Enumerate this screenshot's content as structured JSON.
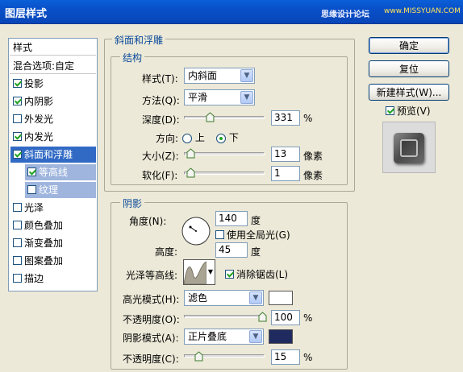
{
  "window": {
    "title": "图层样式",
    "watermark": "思缘设计论坛",
    "watermark_url": "www.MISSYUAN.COM"
  },
  "style_list": {
    "header": "样式",
    "blend_options": "混合选项:自定",
    "items": [
      {
        "label": "投影",
        "checked": true
      },
      {
        "label": "内阴影",
        "checked": true
      },
      {
        "label": "外发光",
        "checked": false
      },
      {
        "label": "内发光",
        "checked": true
      },
      {
        "label": "斜面和浮雕",
        "checked": true,
        "selected": true
      },
      {
        "label": "等高线",
        "checked": true,
        "sub": true
      },
      {
        "label": "纹理",
        "checked": false,
        "sub": true
      },
      {
        "label": "光泽",
        "checked": false
      },
      {
        "label": "颜色叠加",
        "checked": false
      },
      {
        "label": "渐变叠加",
        "checked": false
      },
      {
        "label": "图案叠加",
        "checked": false
      },
      {
        "label": "描边",
        "checked": false
      }
    ]
  },
  "bevel": {
    "group_title": "斜面和浮雕",
    "structure_title": "结构",
    "style_label": "样式(T):",
    "style_value": "内斜面",
    "technique_label": "方法(Q):",
    "technique_value": "平滑",
    "depth_label": "深度(D):",
    "depth_value": "331",
    "depth_unit": "%",
    "direction_label": "方向:",
    "direction_up": "上",
    "direction_down": "下",
    "size_label": "大小(Z):",
    "size_value": "13",
    "size_unit": "像素",
    "soften_label": "软化(F):",
    "soften_value": "1",
    "soften_unit": "像素"
  },
  "shading": {
    "title": "阴影",
    "angle_label": "角度(N):",
    "angle_value": "140",
    "angle_unit": "度",
    "global_light": "使用全局光(G)",
    "altitude_label": "高度:",
    "altitude_value": "45",
    "altitude_unit": "度",
    "gloss_label": "光泽等高线:",
    "antialias": "消除锯齿(L)",
    "highlight_mode_label": "高光模式(H):",
    "highlight_mode_value": "滤色",
    "highlight_opacity_label": "不透明度(O):",
    "highlight_opacity_value": "100",
    "highlight_opacity_unit": "%",
    "shadow_mode_label": "阴影模式(A):",
    "shadow_mode_value": "正片叠底",
    "shadow_opacity_label": "不透明度(C):",
    "shadow_opacity_value": "15",
    "shadow_opacity_unit": "%",
    "highlight_color": "#ffffff",
    "shadow_color": "#1f2b5e"
  },
  "buttons": {
    "ok": "确定",
    "reset": "复位",
    "new_style": "新建样式(W)...",
    "preview": "预览(V)"
  },
  "colors": {
    "title_bar": "#0a5fd8",
    "selection": "#316ac5",
    "sub_selection": "#9fb5dd",
    "dialog_bg": "#ece9d8"
  }
}
